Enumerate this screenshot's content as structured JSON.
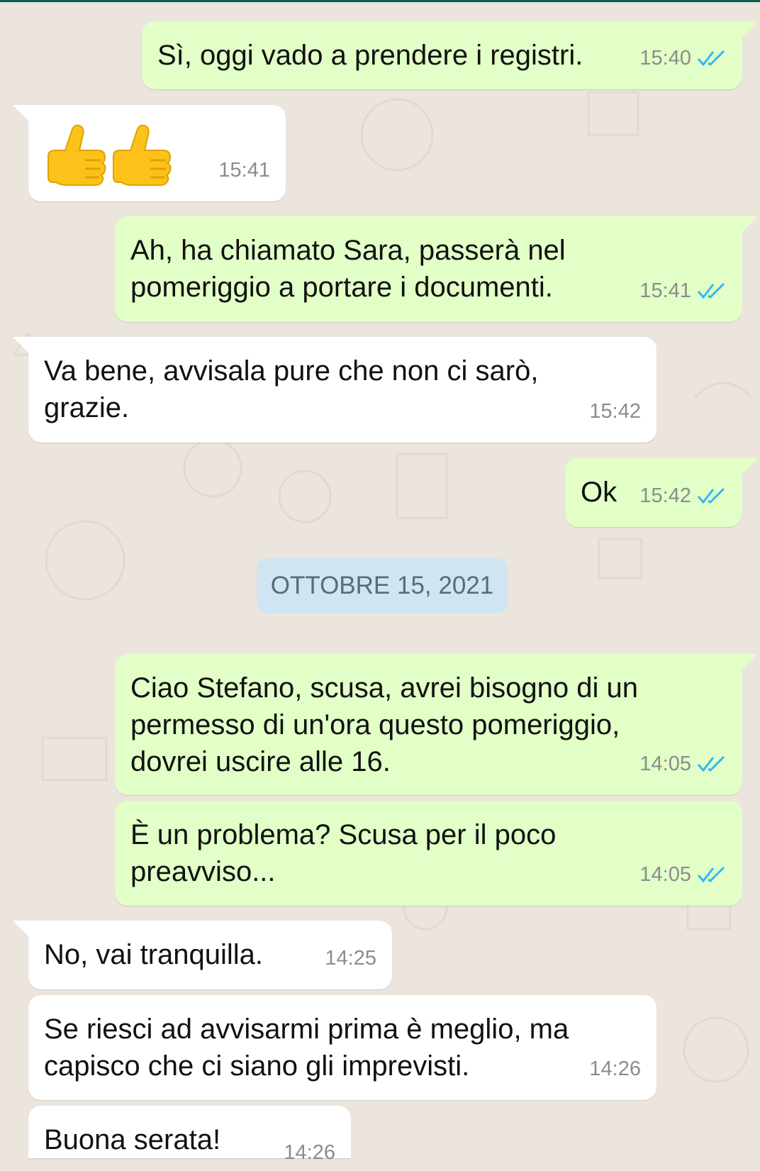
{
  "date_separator": "OTTOBRE 15, 2021",
  "messages": [
    {
      "dir": "out",
      "text": "Sì, oggi vado a prendere i registri.",
      "time": "15:40",
      "status": "read"
    },
    {
      "dir": "in",
      "emoji": "👍👍",
      "time": "15:41"
    },
    {
      "dir": "out",
      "text": "Ah, ha chiamato Sara, passerà nel\npomeriggio a portare i documenti.",
      "time": "15:41",
      "status": "read"
    },
    {
      "dir": "in",
      "text": "Va bene, avvisala pure che non ci sarò,\ngrazie.",
      "time": "15:42"
    },
    {
      "dir": "out",
      "text": "Ok",
      "time": "15:42",
      "status": "read"
    },
    {
      "dir": "out",
      "text": "Ciao Stefano, scusa, avrei bisogno di un\npermesso di un'ora questo pomeriggio,\ndovrei uscire alle 16.",
      "time": "14:05",
      "status": "read"
    },
    {
      "dir": "out",
      "text": "È un problema? Scusa per il poco\npreavviso...",
      "time": "14:05",
      "status": "read"
    },
    {
      "dir": "in",
      "text": "No, vai tranquilla.",
      "time": "14:25"
    },
    {
      "dir": "in",
      "text": "Se riesci ad avvisarmi prima è meglio, ma\ncapisco che ci siano gli imprevisti.",
      "time": "14:26"
    },
    {
      "dir": "in",
      "text": "Buona serata!",
      "time": "14:26"
    }
  ],
  "colors": {
    "outgoing": "#e1ffc7",
    "incoming": "#ffffff",
    "background": "#ece5dd",
    "read_ticks": "#34b7f1"
  },
  "icons": {
    "read_receipt": "double-check-icon",
    "thumbs_up": "thumbs-up-emoji"
  }
}
